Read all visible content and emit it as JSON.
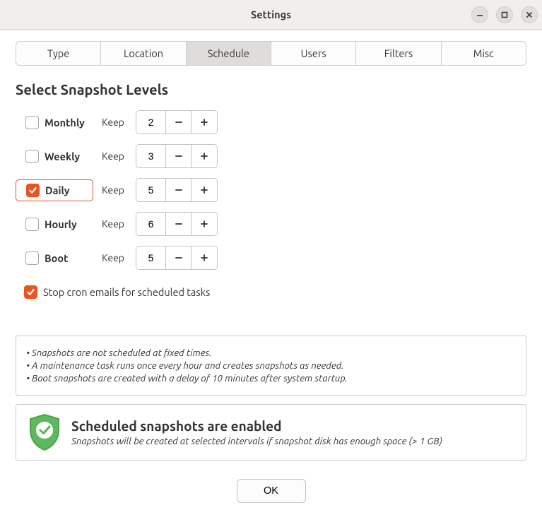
{
  "window": {
    "title": "Settings"
  },
  "tabs": [
    "Type",
    "Location",
    "Schedule",
    "Users",
    "Filters",
    "Misc"
  ],
  "active_tab": 2,
  "section_title": "Select Snapshot Levels",
  "levels": [
    {
      "id": "monthly",
      "label": "Monthly",
      "checked": false,
      "keep": 2
    },
    {
      "id": "weekly",
      "label": "Weekly",
      "checked": false,
      "keep": 3
    },
    {
      "id": "daily",
      "label": "Daily",
      "checked": true,
      "keep": 5,
      "selected": true
    },
    {
      "id": "hourly",
      "label": "Hourly",
      "checked": false,
      "keep": 6
    },
    {
      "id": "boot",
      "label": "Boot",
      "checked": false,
      "keep": 5
    }
  ],
  "keep_label": "Keep",
  "stop_cron": {
    "checked": true,
    "label": "Stop cron emails for scheduled tasks"
  },
  "info_lines": [
    "• Snapshots are not scheduled at fixed times.",
    "• A maintenance task runs once every hour and creates snapshots as needed.",
    "• Boot snapshots are created with a delay of 10 minutes after system startup."
  ],
  "status": {
    "title": "Scheduled snapshots are enabled",
    "desc": "Snapshots will be created at selected intervals if snapshot disk has enough space (> 1 GB)"
  },
  "buttons": {
    "ok": "OK"
  }
}
